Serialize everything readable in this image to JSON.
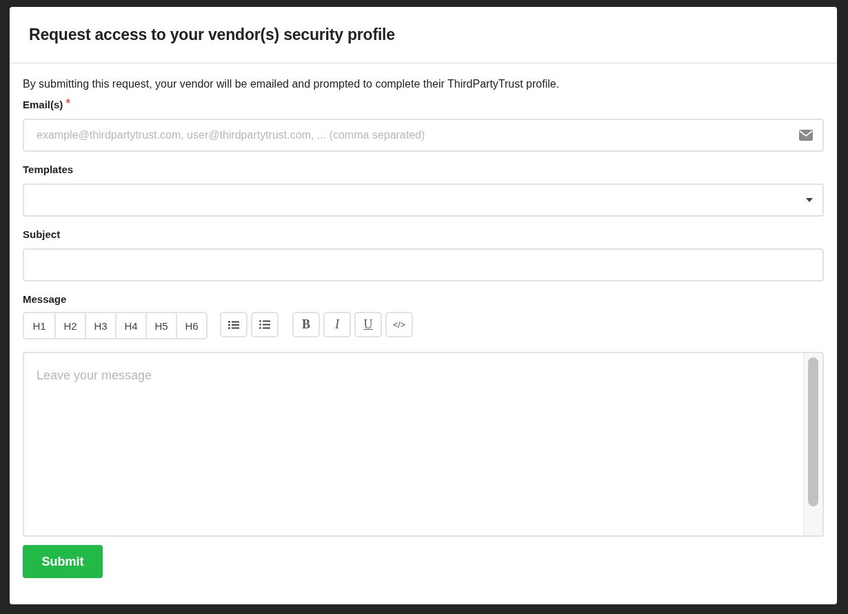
{
  "dialog": {
    "title": "Request access to your vendor(s) security profile"
  },
  "intro": "By submitting this request, your vendor will be emailed and prompted to complete their ThirdPartyTrust profile.",
  "fields": [
    {
      "kind": "email",
      "label": "Email(s)",
      "required_mark": "*",
      "placeholder": "example@thirdpartytrust.com, user@thirdpartytrust.com, ... (comma separated)"
    },
    {
      "kind": "select",
      "label": "Templates"
    },
    {
      "kind": "text",
      "label": "Subject"
    }
  ],
  "message": {
    "label": "Message",
    "placeholder": "Leave your message",
    "headings": [
      "H1",
      "H2",
      "H3",
      "H4",
      "H5",
      "H6"
    ],
    "lists": [
      {
        "kind": "bulleted"
      },
      {
        "kind": "numbered"
      }
    ],
    "formats": [
      {
        "kind": "bold",
        "label": "B"
      },
      {
        "kind": "italic",
        "label": "I"
      },
      {
        "kind": "underline",
        "label": "U"
      },
      {
        "kind": "code",
        "label": "</>"
      }
    ]
  },
  "submit": "Submit"
}
